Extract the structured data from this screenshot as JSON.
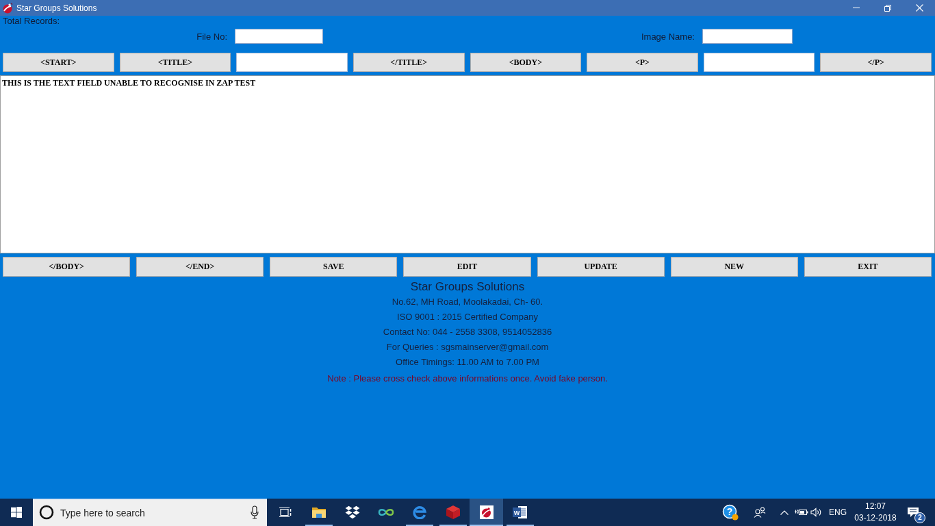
{
  "window": {
    "title": "Star Groups Solutions"
  },
  "header": {
    "total_records_label": "Total Records:"
  },
  "fields": [
    {
      "label": "File No:"
    },
    {
      "label": "Image Name:"
    }
  ],
  "tag_toolbar": [
    {
      "kind": "button",
      "label": "<START>"
    },
    {
      "kind": "button",
      "label": "<TITLE>"
    },
    {
      "kind": "field"
    },
    {
      "kind": "button",
      "label": "</TITLE>"
    },
    {
      "kind": "button",
      "label": "<BODY>"
    },
    {
      "kind": "button",
      "label": "<P>"
    },
    {
      "kind": "field"
    },
    {
      "kind": "button",
      "label": "</P>"
    }
  ],
  "editor": {
    "value": "THIS IS THE TEXT FIELD UNABLE TO RECOGNISE IN ZAP TEST"
  },
  "action_buttons": [
    "</BODY>",
    "</END>",
    "SAVE",
    "EDIT",
    "UPDATE",
    "NEW",
    "EXIT"
  ],
  "company_info": {
    "name": "Star Groups Solutions",
    "lines": [
      "No.62, MH Road, Moolakadai, Ch- 60.",
      "ISO 9001 : 2015 Certified Company",
      "Contact No: 044 - 2558 3308, 9514052836",
      "For Queries : sgsmainserver@gmail.com",
      "Office Timings: 11.00 AM to 7.00 PM"
    ],
    "note": "Note : Please cross check above informations once. Avoid fake person."
  },
  "taskbar": {
    "search": {
      "placeholder": "Type here to search"
    },
    "apps": [
      {
        "kind": "folder",
        "running": true,
        "selected": false
      },
      {
        "kind": "boxes",
        "running": false,
        "selected": false
      },
      {
        "kind": "infinity",
        "running": false,
        "selected": false
      },
      {
        "kind": "browser",
        "running": true,
        "selected": false
      },
      {
        "kind": "cube",
        "running": true,
        "selected": false
      },
      {
        "kind": "logo",
        "running": true,
        "selected": true
      },
      {
        "kind": "document",
        "running": true,
        "selected": false,
        "glyph": "W"
      }
    ],
    "tray": {
      "help_glyph": "?",
      "language": "ENG",
      "time": "12:07",
      "date": "03-12-2018",
      "notification_count": "2"
    }
  }
}
